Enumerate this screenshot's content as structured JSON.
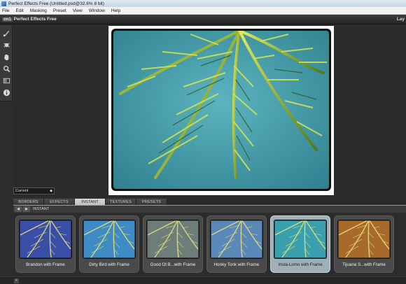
{
  "window": {
    "title": "Perfect Effects Free (Untitled.psd@32.6% 8 bit)"
  },
  "menu": [
    "File",
    "Edit",
    "Masking",
    "Preset",
    "View",
    "Window",
    "Help"
  ],
  "header": {
    "logo": "on1",
    "app_name": "Perfect Effects Free",
    "right_panel_label": "Lay"
  },
  "tools": [
    {
      "name": "brush-tool",
      "icon": "brush-icon"
    },
    {
      "name": "masking-bug-tool",
      "icon": "bug-icon"
    },
    {
      "name": "hand-tool",
      "icon": "hand-icon"
    },
    {
      "name": "zoom-tool",
      "icon": "magnifier-icon"
    },
    {
      "name": "compare-tool",
      "icon": "compare-icon"
    },
    {
      "name": "info-tool",
      "icon": "info-icon"
    }
  ],
  "view_select": {
    "value": "Current"
  },
  "tabs": [
    "BORDERS",
    "EFFECTS",
    "INSTANT",
    "TEXTURES",
    "PRESETS"
  ],
  "active_tab": "INSTANT",
  "breadcrumb": {
    "label": "INSTANT"
  },
  "presets": [
    {
      "label": "Brandon with Frame",
      "tint": "#3a4ea8"
    },
    {
      "label": "Dirty Bird with Frame",
      "tint": "#3f8bc6"
    },
    {
      "label": "Good Ol B...with Frame",
      "tint": "#6d7d7a"
    },
    {
      "label": "Honky Tonk with Frame",
      "tint": "#5a88b8"
    },
    {
      "label": "Insta-Lomo with Frame",
      "tint": "#3aa0b0",
      "selected": true
    },
    {
      "label": "Tijuana S...with Frame",
      "tint": "#a86a2a"
    }
  ],
  "colors": {
    "sky": "#3f9fb0",
    "frond_light": "#d8e84a",
    "frond_dark": "#4f7a1c"
  }
}
